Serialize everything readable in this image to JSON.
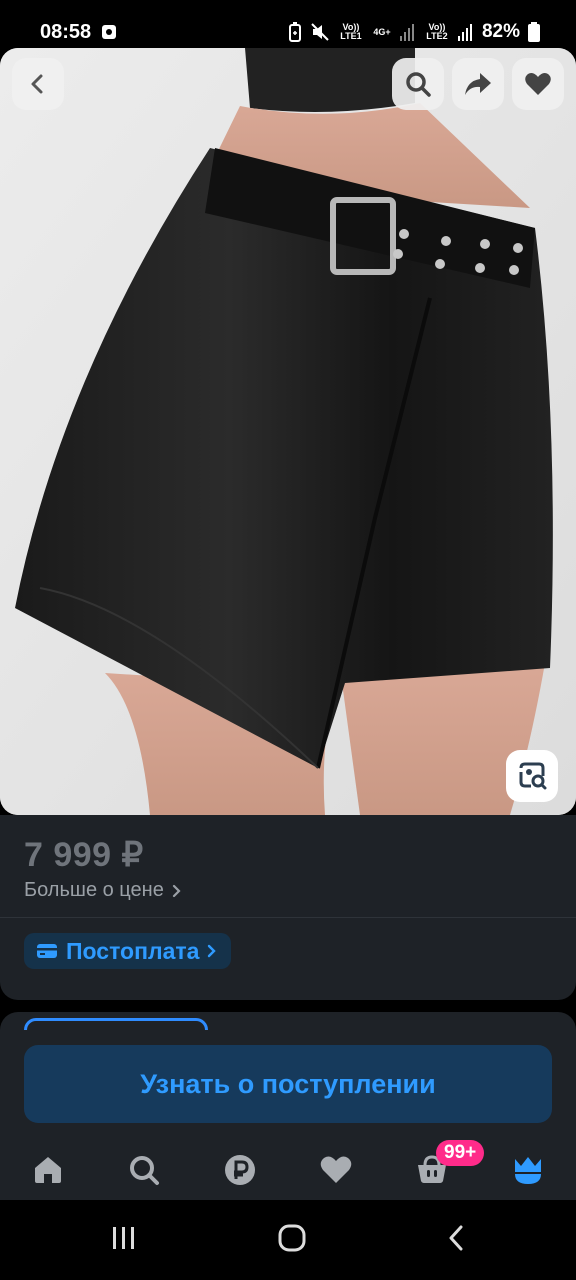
{
  "status_bar": {
    "time": "08:58",
    "lte1": "Vo)) LTE1",
    "lte2": "Vo)) LTE2",
    "net": "4G+",
    "battery": "82%"
  },
  "top_actions": {
    "back_icon": "chevron-left-icon",
    "search_icon": "search-icon",
    "share_icon": "share-icon",
    "favorite_icon": "heart-icon"
  },
  "product": {
    "price": "7 999 ₽",
    "more_price": "Больше о цене",
    "postpay_label": "Постоплата"
  },
  "cta": {
    "notify_label": "Узнать о поступлении"
  },
  "tabbar": {
    "items": [
      "home-icon",
      "search-icon",
      "ruble-icon",
      "heart-icon",
      "cart-icon",
      "profile-icon"
    ],
    "cart_badge": "99+",
    "active_color": "#2f9bff"
  },
  "colors": {
    "accent": "#2f9bff",
    "badge": "#ff2b8a",
    "panel": "#1e2227"
  }
}
